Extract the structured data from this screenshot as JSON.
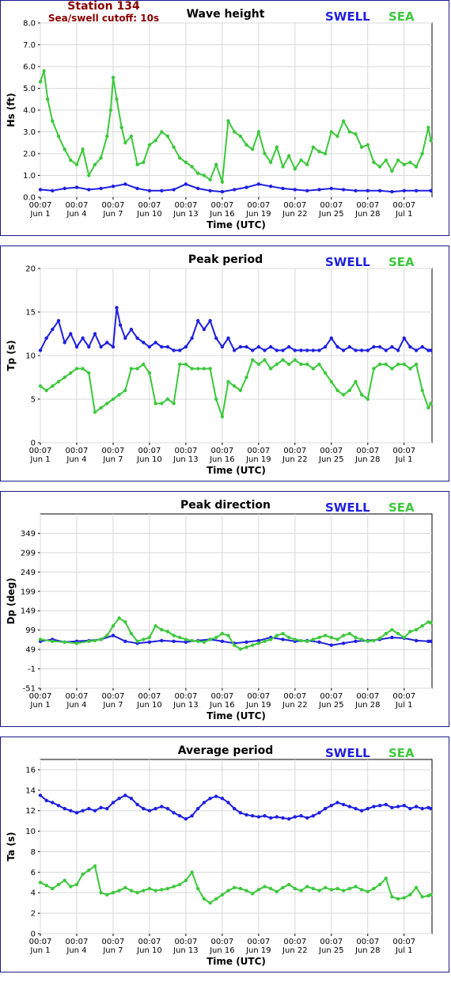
{
  "station": {
    "title": "Station 134",
    "subtitle": "Sea/swell cutoff: 10s"
  },
  "colors": {
    "swell": "#1f1fe0",
    "sea": "#3cc83c",
    "frame": "#1a1a8c"
  },
  "x_axis": {
    "label": "Time (UTC)",
    "range": [
      0,
      32.3
    ],
    "tick_days": [
      0,
      3,
      6,
      9,
      12,
      15,
      18,
      21,
      24,
      27,
      30
    ],
    "tick_time": "00:07",
    "tick_dates": [
      "Jun 1",
      "Jun 4",
      "Jun 7",
      "Jun 10",
      "Jun 13",
      "Jun 16",
      "Jun 19",
      "Jun 22",
      "Jun 25",
      "Jun 28",
      "Jul 1"
    ]
  },
  "chart_data": [
    {
      "type": "line",
      "title": "Wave height",
      "ylabel": "Hs (ft)",
      "ylim": [
        0,
        8
      ],
      "yticks": [
        "0.0",
        "1.0",
        "2.0",
        "3.0",
        "4.0",
        "5.0",
        "6.0",
        "7.0",
        "8.0"
      ],
      "ytick_values": [
        0,
        1,
        2,
        3,
        4,
        5,
        6,
        7,
        8
      ],
      "grid": true,
      "legend": [
        "SWELL",
        "SEA"
      ],
      "legend_position": "top-right",
      "series": [
        {
          "name": "SWELL",
          "x": [
            0,
            1,
            2,
            3,
            4,
            5,
            6,
            7,
            8,
            9,
            10,
            11,
            12,
            13,
            14,
            15,
            16,
            17,
            18,
            19,
            20,
            21,
            22,
            23,
            24,
            25,
            26,
            27,
            28,
            29,
            30,
            31,
            32.2
          ],
          "y": [
            0.35,
            0.3,
            0.4,
            0.45,
            0.35,
            0.4,
            0.5,
            0.6,
            0.4,
            0.3,
            0.3,
            0.35,
            0.6,
            0.4,
            0.3,
            0.25,
            0.35,
            0.45,
            0.6,
            0.5,
            0.4,
            0.35,
            0.3,
            0.35,
            0.4,
            0.35,
            0.3,
            0.3,
            0.3,
            0.25,
            0.3,
            0.3,
            0.3
          ]
        },
        {
          "name": "SEA",
          "x": [
            0,
            0.3,
            0.6,
            1,
            1.5,
            2,
            2.5,
            3,
            3.5,
            4,
            4.5,
            5,
            5.5,
            5.8,
            6,
            6.3,
            6.7,
            7,
            7.5,
            8,
            8.5,
            9,
            9.5,
            10,
            10.5,
            11,
            11.5,
            12,
            12.5,
            13,
            13.5,
            14,
            14.5,
            15,
            15.5,
            16,
            16.5,
            17,
            17.5,
            18,
            18.5,
            19,
            19.5,
            20,
            20.5,
            21,
            21.5,
            22,
            22.5,
            23,
            23.5,
            24,
            24.5,
            25,
            25.5,
            26,
            26.5,
            27,
            27.5,
            28,
            28.5,
            29,
            29.5,
            30,
            30.5,
            31,
            31.5,
            32,
            32.2
          ],
          "y": [
            5.3,
            5.8,
            4.5,
            3.5,
            2.8,
            2.2,
            1.7,
            1.5,
            2.2,
            1.0,
            1.5,
            1.8,
            2.8,
            4.0,
            5.5,
            4.5,
            3.2,
            2.5,
            2.8,
            1.5,
            1.6,
            2.4,
            2.6,
            3.0,
            2.8,
            2.3,
            1.8,
            1.6,
            1.4,
            1.1,
            1.0,
            0.8,
            1.5,
            0.7,
            3.5,
            3.0,
            2.8,
            2.4,
            2.2,
            3.0,
            2.0,
            1.6,
            2.3,
            1.4,
            1.9,
            1.3,
            1.7,
            1.5,
            2.3,
            2.1,
            2.0,
            3.0,
            2.8,
            3.5,
            3.0,
            2.9,
            2.3,
            2.4,
            1.6,
            1.4,
            1.7,
            1.2,
            1.7,
            1.5,
            1.6,
            1.4,
            2.0,
            3.2,
            2.6
          ]
        }
      ]
    },
    {
      "type": "line",
      "title": "Peak period",
      "ylabel": "Tp (s)",
      "ylim": [
        0,
        20
      ],
      "yticks": [
        "0",
        "5",
        "10",
        "15",
        "20"
      ],
      "ytick_values": [
        0,
        5,
        10,
        15,
        20
      ],
      "grid": true,
      "legend": [
        "SWELL",
        "SEA"
      ],
      "legend_position": "top-right",
      "series": [
        {
          "name": "SWELL",
          "x": [
            0,
            0.5,
            1,
            1.5,
            2,
            2.5,
            3,
            3.5,
            4,
            4.5,
            5,
            5.5,
            6,
            6.3,
            6.6,
            7,
            7.5,
            8,
            8.5,
            9,
            9.5,
            10,
            10.5,
            11,
            11.5,
            12,
            12.5,
            13,
            13.5,
            14,
            14.5,
            15,
            15.5,
            16,
            16.5,
            17,
            17.5,
            18,
            18.5,
            19,
            19.5,
            20,
            20.5,
            21,
            21.5,
            22,
            22.5,
            23,
            23.5,
            24,
            24.5,
            25,
            25.5,
            26,
            26.5,
            27,
            27.5,
            28,
            28.5,
            29,
            29.5,
            30,
            30.5,
            31,
            31.5,
            32,
            32.2
          ],
          "y": [
            10.6,
            12,
            13,
            14,
            11.5,
            12.5,
            11,
            12,
            11,
            12.5,
            11,
            11.5,
            11,
            15.5,
            13.5,
            12,
            13,
            12,
            11.5,
            11,
            11.5,
            11,
            11,
            10.6,
            10.6,
            11,
            12,
            14,
            13,
            14,
            12,
            11,
            12,
            10.6,
            11,
            11,
            10.6,
            11,
            10.6,
            11,
            10.6,
            10.6,
            11,
            10.6,
            10.6,
            10.6,
            10.6,
            10.6,
            11,
            12,
            11,
            10.6,
            11,
            10.6,
            10.6,
            10.6,
            11,
            11,
            10.6,
            11,
            10.6,
            12,
            11,
            10.6,
            11,
            10.6,
            10.6
          ]
        },
        {
          "name": "SEA",
          "x": [
            0,
            0.5,
            1,
            1.5,
            2,
            2.5,
            3,
            3.5,
            4,
            4.5,
            5,
            5.5,
            6,
            6.5,
            7,
            7.5,
            8,
            8.5,
            9,
            9.5,
            10,
            10.5,
            11,
            11.5,
            12,
            12.5,
            13,
            13.5,
            14,
            14.5,
            15,
            15.5,
            16,
            16.5,
            17,
            17.5,
            18,
            18.5,
            19,
            19.5,
            20,
            20.5,
            21,
            21.5,
            22,
            22.5,
            23,
            23.5,
            24,
            24.5,
            25,
            25.5,
            26,
            26.5,
            27,
            27.5,
            28,
            28.5,
            29,
            29.5,
            30,
            30.5,
            31,
            31.5,
            32,
            32.2
          ],
          "y": [
            6.5,
            6,
            6.5,
            7,
            7.5,
            8,
            8.5,
            8.5,
            8,
            3.5,
            4,
            4.5,
            5,
            5.5,
            6,
            8.5,
            8.5,
            9,
            8,
            4.5,
            4.5,
            5,
            4.5,
            9,
            9,
            8.5,
            8.5,
            8.5,
            8.5,
            5,
            3,
            7,
            6.5,
            6,
            7.5,
            9.5,
            9,
            9.5,
            8.5,
            9,
            9.5,
            9,
            9.5,
            9,
            9,
            8.5,
            9,
            8,
            7,
            6,
            5.5,
            6,
            7,
            5.5,
            5,
            8.5,
            9,
            9,
            8.5,
            9,
            9,
            8.5,
            9,
            6,
            4,
            4.5
          ]
        }
      ]
    },
    {
      "type": "line",
      "title": "Peak direction",
      "ylabel": "Dp (deg)",
      "ylim": [
        -51,
        399
      ],
      "yticks": [
        "-51",
        "-1",
        "49",
        "99",
        "149",
        "199",
        "249",
        "299",
        "349"
      ],
      "ytick_values": [
        -51,
        -1,
        49,
        99,
        149,
        199,
        249,
        299,
        349
      ],
      "grid": true,
      "legend": [
        "SWELL",
        "SEA"
      ],
      "legend_position": "top-right",
      "series": [
        {
          "name": "SWELL",
          "x": [
            0,
            1,
            2,
            3,
            4,
            5,
            6,
            7,
            8,
            9,
            10,
            11,
            12,
            13,
            14,
            15,
            16,
            17,
            18,
            19,
            20,
            21,
            22,
            23,
            24,
            25,
            26,
            27,
            28,
            29,
            30,
            31,
            32,
            32.2
          ],
          "y": [
            70,
            75,
            68,
            70,
            72,
            75,
            85,
            70,
            65,
            68,
            72,
            70,
            68,
            72,
            75,
            70,
            65,
            68,
            72,
            80,
            75,
            70,
            72,
            68,
            60,
            65,
            70,
            72,
            75,
            80,
            78,
            72,
            70,
            70
          ]
        },
        {
          "name": "SEA",
          "x": [
            0,
            1,
            2,
            3,
            4,
            4.5,
            5,
            5.5,
            6,
            6.5,
            7,
            7.5,
            8,
            8.5,
            9,
            9.5,
            10,
            10.5,
            11,
            11.5,
            12,
            12.5,
            13,
            13.5,
            14,
            14.5,
            15,
            15.5,
            16,
            16.5,
            17,
            17.5,
            18,
            18.5,
            19,
            19.5,
            20,
            20.5,
            21,
            21.5,
            22,
            22.5,
            23,
            23.5,
            24,
            24.5,
            25,
            25.5,
            26,
            26.5,
            27,
            27.5,
            28,
            28.5,
            29,
            29.5,
            30,
            30.5,
            31,
            31.5,
            32,
            32.2
          ],
          "y": [
            75,
            70,
            68,
            65,
            70,
            72,
            75,
            85,
            110,
            130,
            120,
            90,
            70,
            75,
            80,
            110,
            100,
            95,
            85,
            80,
            75,
            72,
            70,
            68,
            75,
            80,
            90,
            85,
            60,
            50,
            55,
            60,
            65,
            70,
            75,
            85,
            90,
            80,
            75,
            72,
            70,
            75,
            80,
            85,
            80,
            75,
            85,
            90,
            80,
            75,
            70,
            72,
            78,
            90,
            100,
            90,
            80,
            95,
            100,
            110,
            120,
            118
          ]
        }
      ]
    },
    {
      "type": "line",
      "title": "Average period",
      "ylabel": "Ta (s)",
      "ylim": [
        0,
        17
      ],
      "yticks": [
        "0",
        "2",
        "4",
        "6",
        "8",
        "10",
        "12",
        "14",
        "16"
      ],
      "ytick_values": [
        0,
        2,
        4,
        6,
        8,
        10,
        12,
        14,
        16
      ],
      "grid": true,
      "legend": [
        "SWELL",
        "SEA"
      ],
      "legend_position": "top-right",
      "series": [
        {
          "name": "SWELL",
          "x": [
            0,
            0.5,
            1,
            1.5,
            2,
            2.5,
            3,
            3.5,
            4,
            4.5,
            5,
            5.5,
            6,
            6.5,
            7,
            7.5,
            8,
            8.5,
            9,
            9.5,
            10,
            10.5,
            11,
            11.5,
            12,
            12.5,
            13,
            13.5,
            14,
            14.5,
            15,
            15.5,
            16,
            16.5,
            17,
            17.5,
            18,
            18.5,
            19,
            19.5,
            20,
            20.5,
            21,
            21.5,
            22,
            22.5,
            23,
            23.5,
            24,
            24.5,
            25,
            25.5,
            26,
            26.5,
            27,
            27.5,
            28,
            28.5,
            29,
            29.5,
            30,
            30.5,
            31,
            31.5,
            32,
            32.2
          ],
          "y": [
            13.5,
            13,
            12.8,
            12.5,
            12.2,
            12,
            11.8,
            12,
            12.2,
            12,
            12.3,
            12.2,
            12.8,
            13.2,
            13.5,
            13.2,
            12.6,
            12.2,
            12,
            12.2,
            12.4,
            12.2,
            11.8,
            11.5,
            11.2,
            11.5,
            12.2,
            12.8,
            13.2,
            13.4,
            13.2,
            12.8,
            12.2,
            11.8,
            11.6,
            11.5,
            11.4,
            11.5,
            11.3,
            11.4,
            11.3,
            11.2,
            11.4,
            11.5,
            11.3,
            11.5,
            11.8,
            12.2,
            12.5,
            12.8,
            12.6,
            12.4,
            12.2,
            12,
            12.2,
            12.4,
            12.5,
            12.6,
            12.3,
            12.4,
            12.5,
            12.2,
            12.4,
            12.2,
            12.3,
            12.2
          ]
        },
        {
          "name": "SEA",
          "x": [
            0,
            0.5,
            1,
            1.5,
            2,
            2.5,
            3,
            3.5,
            4,
            4.5,
            5,
            5.5,
            6,
            6.5,
            7,
            7.5,
            8,
            8.5,
            9,
            9.5,
            10,
            10.5,
            11,
            11.5,
            12,
            12.5,
            13,
            13.5,
            14,
            14.5,
            15,
            15.5,
            16,
            16.5,
            17,
            17.5,
            18,
            18.5,
            19,
            19.5,
            20,
            20.5,
            21,
            21.5,
            22,
            22.5,
            23,
            23.5,
            24,
            24.5,
            25,
            25.5,
            26,
            26.5,
            27,
            27.5,
            28,
            28.5,
            29,
            29.5,
            30,
            30.5,
            31,
            31.5,
            32,
            32.2
          ],
          "y": [
            5,
            4.7,
            4.4,
            4.8,
            5.2,
            4.6,
            4.8,
            5.8,
            6.2,
            6.6,
            4,
            3.8,
            4,
            4.2,
            4.5,
            4.2,
            4,
            4.2,
            4.4,
            4.2,
            4.3,
            4.4,
            4.6,
            4.8,
            5.2,
            6,
            4.4,
            3.4,
            3,
            3.4,
            3.8,
            4.2,
            4.5,
            4.4,
            4.2,
            3.9,
            4.3,
            4.6,
            4.4,
            4.1,
            4.5,
            4.8,
            4.4,
            4.2,
            4.6,
            4.4,
            4.2,
            4.5,
            4.3,
            4.4,
            4.2,
            4.4,
            4.6,
            4.3,
            4.1,
            4.4,
            4.8,
            5.4,
            3.6,
            3.4,
            3.5,
            3.8,
            4.5,
            3.6,
            3.7,
            3.8
          ]
        }
      ]
    }
  ]
}
